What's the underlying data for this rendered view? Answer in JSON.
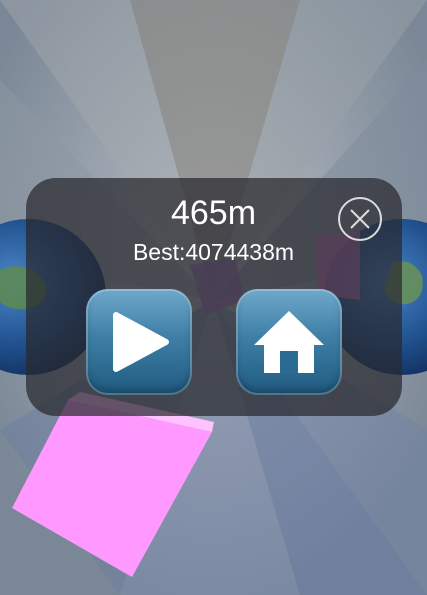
{
  "hud": {
    "distance": "465m",
    "best": "Best:4074438m"
  },
  "colors": {
    "panel": "#28282e",
    "button": "#3f7fa6",
    "text": "#ffffff",
    "pink_block": "#ff99ff"
  },
  "icons": {
    "close": "close-circle-icon",
    "play": "play-icon",
    "home": "home-icon"
  }
}
